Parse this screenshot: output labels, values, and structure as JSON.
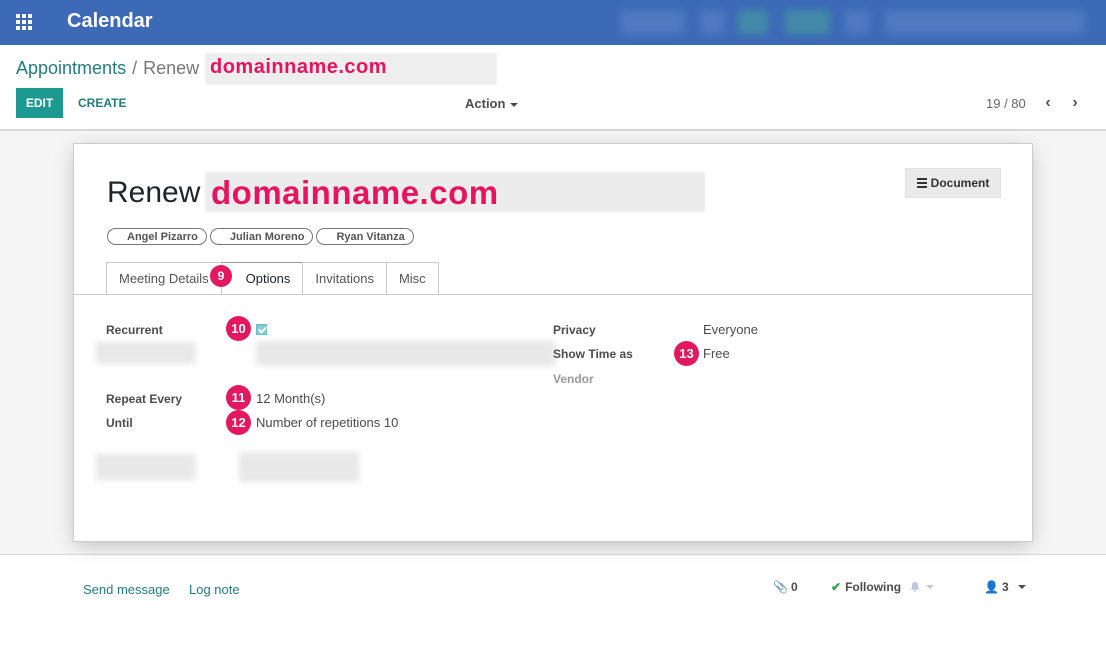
{
  "app": {
    "title": "Calendar"
  },
  "breadcrumb": {
    "parent": "Appointments",
    "separator": "/",
    "current": "Renew",
    "domain": "domainname.com"
  },
  "toolbar": {
    "edit_label": "EDIT",
    "create_label": "CREATE",
    "action_label": "Action"
  },
  "pager": {
    "value": "19 / 80"
  },
  "record": {
    "title_prefix": "Renew",
    "title_domain": "domainname.com",
    "document_button": "Document",
    "attendees": [
      "Angel Pizarro",
      "Julian Moreno",
      "Ryan Vitanza"
    ]
  },
  "tabs": [
    "Meeting Details",
    "Options",
    "Invitations",
    "Misc"
  ],
  "active_tab": "Options",
  "options": {
    "recurrent_label": "Recurrent",
    "recurrent_checked": true,
    "repeat_every_label": "Repeat Every",
    "repeat_every_value": "12",
    "repeat_every_unit": "Month(s)",
    "until_label": "Until",
    "until_value": "Number of repetitions",
    "until_count": "10",
    "privacy_label": "Privacy",
    "privacy_value": "Everyone",
    "show_time_label": "Show Time as",
    "show_time_value": "Free",
    "vendor_label": "Vendor"
  },
  "badges": [
    "9",
    "10",
    "11",
    "12",
    "13"
  ],
  "chatter": {
    "send_message": "Send message",
    "log_note": "Log note",
    "attachments_count": "0",
    "following_label": "Following",
    "followers_count": "3"
  },
  "colors": {
    "navbar": "#3c6ab7",
    "primary": "#1c9a92",
    "link": "#217c7f",
    "badge": "#e4185f",
    "domain_highlight": "#e8135f"
  }
}
